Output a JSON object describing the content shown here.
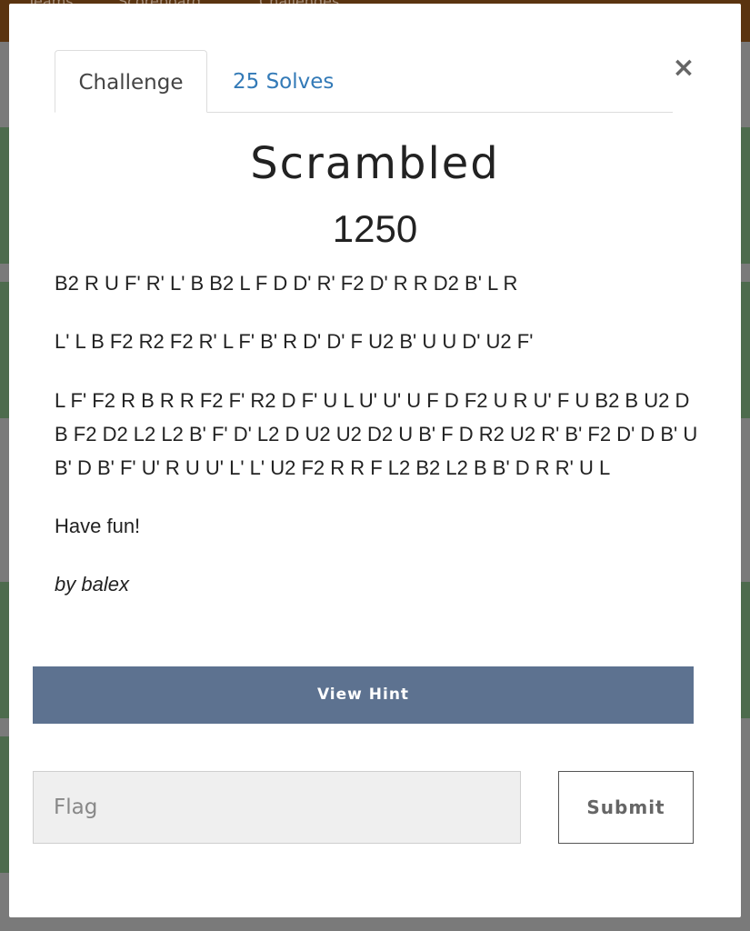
{
  "background": {
    "nav_items": [
      "Teams",
      "Scoreboard",
      "Challenges"
    ]
  },
  "modal": {
    "tabs": [
      {
        "label": "Challenge"
      },
      {
        "label": "25 Solves"
      }
    ],
    "close_glyph": "×",
    "title": "Scrambled",
    "points": "1250",
    "description": [
      "B2 R U F' R' L' B B2 L F D D' R' F2 D' R R D2 B' L R",
      "L' L B F2 R2 F2 R' L F' B' R D' D' F U2 B' U U D' U2 F'",
      "L F' F2 R B R R F2 F' R2 D F' U L U' U' U F D F2 U R U' F U B2 B U2 D B F2 D2 L2 L2 B' F' D' L2 D U2 U2 D2 U B' F D R2 U2 R' B' F2 D' D B' U B' D B' F' U' R U U' L' L' U2 F2 R R F L2 B2 L2 B B' D R R' U L",
      "Have fun!"
    ],
    "author": "by balex",
    "hint_button": "View Hint",
    "flag_placeholder": "Flag",
    "flag_value": "",
    "submit_button": "Submit"
  },
  "colors": {
    "hint_button_bg": "#5d7290",
    "tab_link": "#337ab7",
    "backdrop": "#7a7a7a"
  }
}
